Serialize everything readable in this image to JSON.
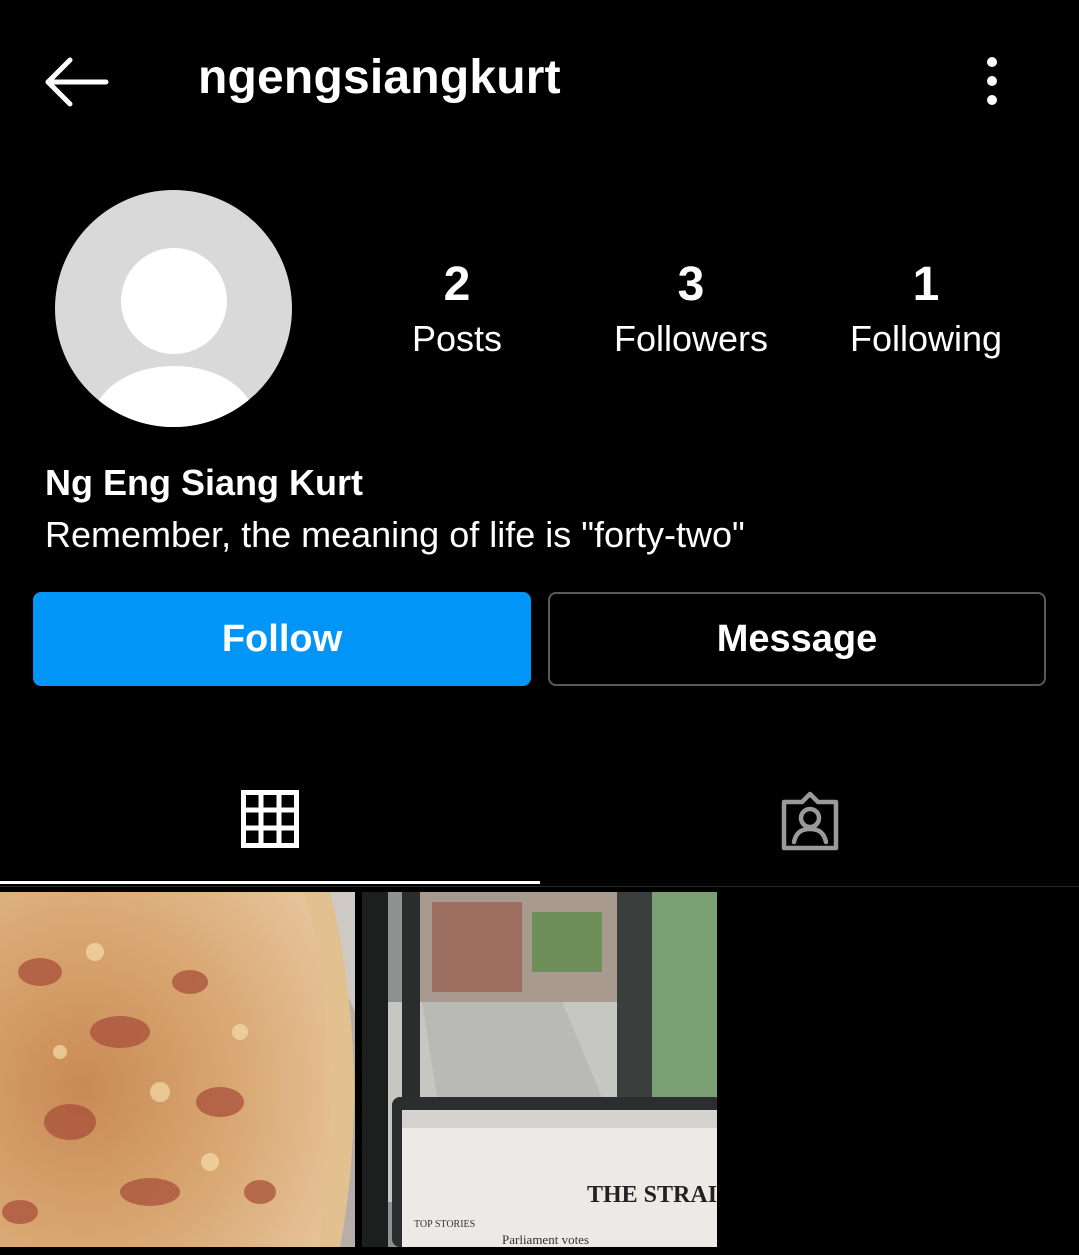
{
  "header": {
    "username": "ngengsiangkurt",
    "back_icon": "arrow-left-icon",
    "menu_icon": "more-vertical-icon"
  },
  "profile": {
    "avatar_icon": "default-avatar-icon",
    "full_name": "Ng Eng Siang Kurt",
    "bio": "Remember, the meaning of life is \"forty-two\""
  },
  "stats": {
    "posts": {
      "count": "2",
      "label": "Posts"
    },
    "followers": {
      "count": "3",
      "label": "Followers"
    },
    "following": {
      "count": "1",
      "label": "Following"
    }
  },
  "actions": {
    "follow_label": "Follow",
    "message_label": "Message"
  },
  "tabs": [
    {
      "icon": "grid-icon",
      "active": true
    },
    {
      "icon": "tagged-person-icon",
      "active": false
    }
  ],
  "posts": [
    {
      "subject": "pizza photo"
    },
    {
      "subject": "laptop by window photo",
      "visible_text": "THE STRAIT"
    }
  ],
  "colors": {
    "background": "#000000",
    "accent": "#0095f6",
    "text": "#ffffff"
  }
}
